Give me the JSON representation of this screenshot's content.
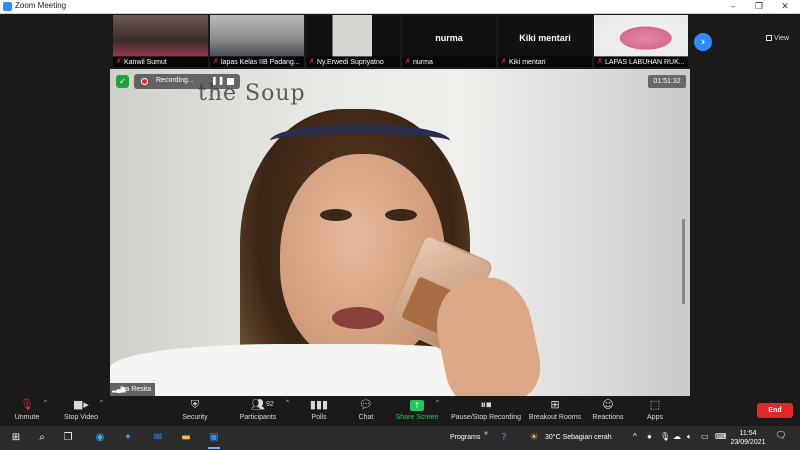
{
  "window": {
    "title": "Zoom Meeting"
  },
  "gallery": {
    "tiles": [
      {
        "name": "Kanwil Sumut",
        "type": "video"
      },
      {
        "name": "lapas Kelas IIB Padang...",
        "type": "video"
      },
      {
        "name": "Ny.Erwedi Supriyatno",
        "type": "video"
      },
      {
        "name": "nurma",
        "type": "name",
        "display": "nurma"
      },
      {
        "name": "Kiki mentari",
        "type": "name",
        "display": "Kiki mentari"
      },
      {
        "name": "LAPAS LABUHAN RUK...",
        "type": "video"
      }
    ],
    "next_icon": "chevron-right-icon",
    "view_label": "View"
  },
  "stage": {
    "wall_text": "the Soup",
    "recording_label": "Recording...",
    "timer": "01:51:32",
    "speaker_name": "Ika Resita"
  },
  "toolbar": {
    "unmute": "Unmute",
    "stop_video": "Stop Video",
    "security": "Security",
    "participants": "Participants",
    "participants_count": "92",
    "polls": "Polls",
    "chat": "Chat",
    "share_screen": "Share Screen",
    "pause_stop_recording": "Pause/Stop Recording",
    "breakout_rooms": "Breakout Rooms",
    "reactions": "Reactions",
    "apps": "Apps",
    "end": "End"
  },
  "taskbar": {
    "programs_label": "Programs",
    "weather": "30°C  Sebagian cerah",
    "time": "11:54",
    "date": "23/09/2021"
  },
  "colors": {
    "zoom_blue": "#2d8cff",
    "share_green": "#22c55e",
    "end_red": "#e02828",
    "toolbar_bg": "#1a1a1a"
  }
}
